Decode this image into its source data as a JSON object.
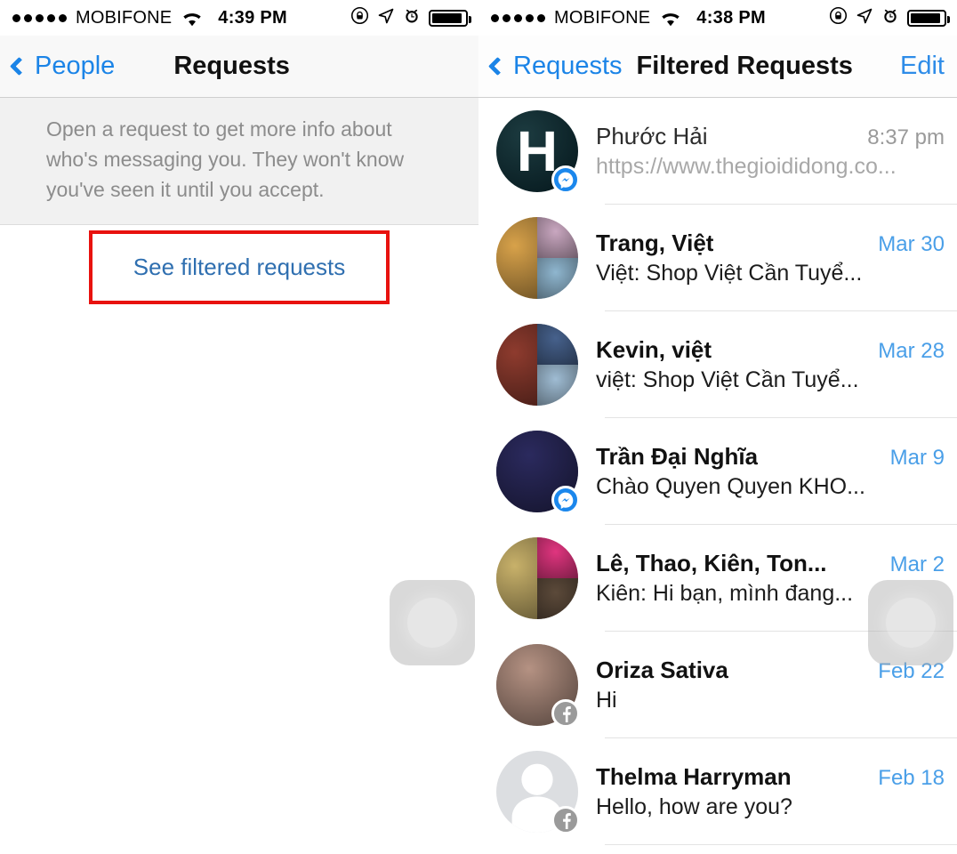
{
  "left_panel": {
    "status_bar": {
      "signal_dots": 5,
      "carrier": "MOBIFONE",
      "wifi_icon": "wifi-icon",
      "time": "4:39 PM",
      "icons": [
        "rotation-lock-icon",
        "location-arrow-icon",
        "alarm-clock-icon",
        "battery-icon"
      ]
    },
    "nav": {
      "back_label": "People",
      "title": "Requests",
      "back_icon": "chevron-left-icon"
    },
    "info_text": "Open a request to get more info about who's messaging you. They won't know you've seen it until you accept.",
    "see_filtered_label": "See filtered requests",
    "highlight_color": "#e8120f",
    "link_color": "#2f6fb0"
  },
  "right_panel": {
    "status_bar": {
      "signal_dots": 5,
      "carrier": "MOBIFONE",
      "wifi_icon": "wifi-icon",
      "time": "4:38 PM",
      "icons": [
        "rotation-lock-icon",
        "location-arrow-icon",
        "alarm-clock-icon",
        "battery-icon"
      ]
    },
    "nav": {
      "back_label": "Requests",
      "title": "Filtered Requests",
      "edit_label": "Edit",
      "back_icon": "chevron-left-icon"
    },
    "threads": [
      {
        "name": "Phước Hải",
        "snippet": "https://www.thegioididong.co...",
        "time": "8:37 pm",
        "time_style": "gray",
        "name_style": "regular",
        "snippet_style": "muted",
        "badge": "messenger",
        "avatar_type": "letter",
        "avatar_letter": "H"
      },
      {
        "name": "Trang, Việt",
        "snippet": "Việt: Shop Việt Cần Tuyể...",
        "time": "Mar 30",
        "time_style": "blue",
        "name_style": "bold",
        "snippet_style": "normal",
        "badge": "none",
        "avatar_type": "mosaic",
        "avatar_colors": [
          "#d8a24a",
          "#c9a7c0",
          "#8fb6cf"
        ]
      },
      {
        "name": "Kevin, việt",
        "snippet": "việt: Shop Việt Cần Tuyể...",
        "time": "Mar 28",
        "time_style": "blue",
        "name_style": "bold",
        "snippet_style": "normal",
        "badge": "none",
        "avatar_type": "mosaic",
        "avatar_colors": [
          "#8e3b2e",
          "#46618c",
          "#9fbcd3"
        ]
      },
      {
        "name": "Trần Đại Nghĩa",
        "snippet": "Chào Quyen Quyen KHO...",
        "time": "Mar 9",
        "time_style": "blue",
        "name_style": "bold",
        "snippet_style": "normal",
        "badge": "messenger",
        "avatar_type": "image",
        "avatar_colors": [
          "#2b2a5e"
        ]
      },
      {
        "name": "Lê, Thao, Kiên, Ton...",
        "snippet": "Kiên: Hi bạn,  mình đang...",
        "time": "Mar 2",
        "time_style": "blue",
        "name_style": "bold",
        "snippet_style": "normal",
        "badge": "none",
        "avatar_type": "mosaic",
        "avatar_colors": [
          "#c8b16a",
          "#e0357f",
          "#5c4a3a"
        ]
      },
      {
        "name": "Oriza Sativa",
        "snippet": "Hi",
        "time": "Feb 22",
        "time_style": "blue",
        "name_style": "bold",
        "snippet_style": "normal",
        "badge": "facebook",
        "avatar_type": "image",
        "avatar_colors": [
          "#b59283"
        ]
      },
      {
        "name": "Thelma Harryman",
        "snippet": "Hello, how are you?",
        "time": "Feb 18",
        "time_style": "blue",
        "name_style": "bold",
        "snippet_style": "normal",
        "badge": "facebook",
        "avatar_type": "default",
        "avatar_colors": [
          "#dcdee1"
        ]
      }
    ]
  },
  "overlays": {
    "assistive_touch_left": "assistive-touch-button",
    "assistive_touch_right": "assistive-touch-button"
  }
}
